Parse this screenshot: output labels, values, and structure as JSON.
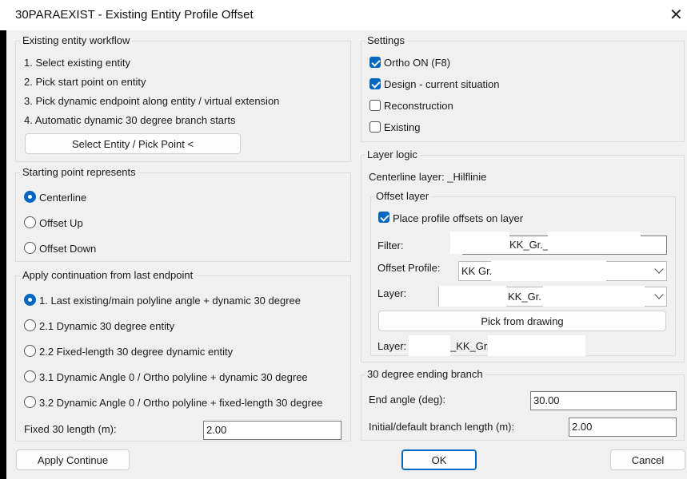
{
  "window": {
    "title": "30PARAEXIST - Existing Entity Profile Offset",
    "close_symbol": "✕"
  },
  "workflow": {
    "legend": "Existing entity workflow",
    "steps": [
      "1. Select existing entity",
      "2. Pick start point on entity",
      "3. Pick dynamic endpoint along entity / virtual extension",
      "4. Automatic dynamic 30 degree branch starts"
    ],
    "select_button": "Select Entity / Pick Point <"
  },
  "starting_point": {
    "legend": "Starting point represents",
    "options": [
      "Centerline",
      "Offset Up",
      "Offset Down"
    ],
    "selected_index": 0
  },
  "continuation": {
    "legend": "Apply continuation from last endpoint",
    "options": [
      "1. Last existing/main polyline angle + dynamic 30 degree",
      "2.1 Dynamic 30 degree entity",
      "2.2 Fixed-length 30 degree dynamic entity",
      "3.1 Dynamic Angle 0 / Ortho polyline + dynamic 30 degree",
      "3.2 Dynamic Angle 0 / Ortho polyline + fixed-length 30 degree"
    ],
    "selected_index": 0,
    "fixed_length_label": "Fixed 30 length (m):",
    "fixed_length_value": "2.00"
  },
  "settings": {
    "legend": "Settings",
    "items": [
      {
        "label": "Ortho ON (F8)",
        "checked": true
      },
      {
        "label": "Design - current situation",
        "checked": true
      },
      {
        "label": "Reconstruction",
        "checked": false
      },
      {
        "label": "Existing",
        "checked": false
      }
    ]
  },
  "layer_logic": {
    "legend": "Layer logic",
    "centerline_label": "Centerline layer: _Hilflinie",
    "offset_layer": {
      "legend": "Offset layer",
      "place_label": "Place profile offsets on layer",
      "place_checked": true,
      "filter_label": "Filter:",
      "filter_value": "KK_Gr._",
      "offset_profile_label": "Offset Profile:",
      "offset_profile_value": "KK Gr.",
      "layer_label": "Layer:",
      "layer_value": "KK_Gr.",
      "pick_button": "Pick from drawing",
      "result_label": "Layer:",
      "result_value": "_KK_Gr."
    }
  },
  "ending_branch": {
    "legend": "30 degree ending branch",
    "end_angle_label": "End angle (deg):",
    "end_angle_value": "30.00",
    "branch_length_label": "Initial/default branch length (m):",
    "branch_length_value": "2.00"
  },
  "footer": {
    "apply_button": "Apply Continue",
    "ok_button": "OK",
    "cancel_button": "Cancel"
  }
}
